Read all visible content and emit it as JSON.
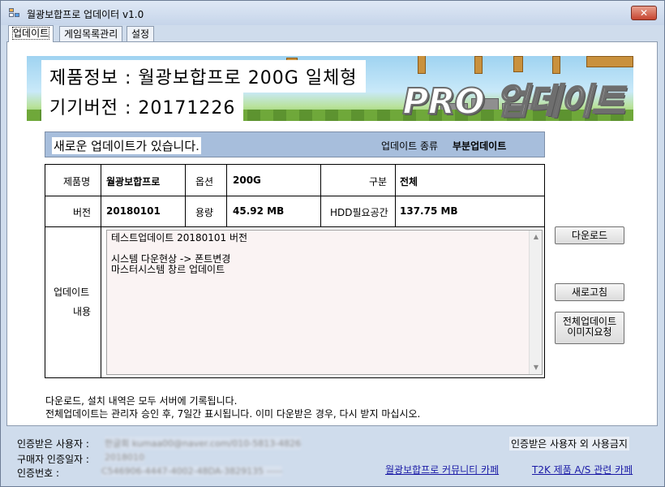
{
  "window": {
    "title": "월광보합프로 업데이터 v1.0",
    "close_glyph": "✕"
  },
  "tabs": [
    {
      "label": "업데이트",
      "active": true
    },
    {
      "label": "게임목록관리",
      "active": false
    },
    {
      "label": "설정",
      "active": false
    }
  ],
  "banner": {
    "product_info": "제품정보 :  월광보합프로 200G 일체형",
    "device_version": "기기버전 :  20171226",
    "logo": "PRO 업데이트"
  },
  "notice": {
    "message": "새로운 업데이트가 있습니다.",
    "update_type_label": "업데이트 종류",
    "update_type_value": "부분업데이트"
  },
  "table": {
    "product_name_label": "제품명",
    "product_name_value": "월광보합프로",
    "option_label": "옵션",
    "option_value": "200G",
    "category_label": "구분",
    "category_value": "전체",
    "version_label": "버전",
    "version_value": "20180101",
    "size_label": "용량",
    "size_value": "45.92 MB",
    "hdd_label": "HDD필요공간",
    "hdd_value": "137.75 MB",
    "content_label_1": "업데이트",
    "content_label_2": "내용",
    "content_lines": [
      "테스트업데이트 20180101 버전",
      "",
      "시스템 다운현상 -> 폰트변경",
      "마스터시스템 창르 업데이트"
    ]
  },
  "buttons": {
    "download": "다운로드",
    "refresh": "새로고침",
    "full_update_line1": "전체업데이트",
    "full_update_line2": "이미지요청"
  },
  "footnotes": [
    "다운로드, 설치 내역은 모두 서버에 기록됩니다.",
    "전체업데이트는 관리자 승인 후, 7일간 표시됩니다. 이미 다운받은 경우, 다시 받지 마십시오."
  ],
  "status": {
    "certified_user_label": "인증받은 사용자 :",
    "certified_user_value": "한글회 kumaa00@naver.com/010-5813-4826",
    "purchase_date_label": "구매자 인증일자 :",
    "purchase_date_value": "2018010",
    "auth_number_label": "인증번호 :",
    "auth_number_value": "C546906-4447-4002-48DA-3829135 -----",
    "restriction_notice": "인증받은 사용자 외 사용금지",
    "community_link": "월광보합프로 커뮤니티 카페",
    "support_link": "T2K 제품 A/S 관련 카페"
  }
}
